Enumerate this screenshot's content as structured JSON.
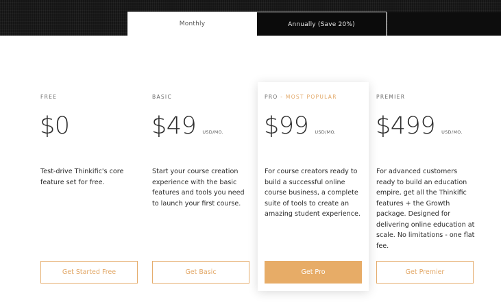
{
  "toggle": {
    "monthly_label": "Monthly",
    "annual_label": "Annually (Save 20%)",
    "selected": "Monthly"
  },
  "plans": [
    {
      "name": "FREE",
      "tag": "",
      "price": "$0",
      "unit": "",
      "description": "Test-drive Thinkific's core feature set for free.",
      "cta": "Get Started Free"
    },
    {
      "name": "BASIC",
      "tag": "",
      "price": "$49",
      "unit": "USD/MO.",
      "description": "Start your course creation experience with the basic features and tools you need to launch your first course.",
      "cta": "Get Basic"
    },
    {
      "name": "PRO",
      "tag": " - MOST POPULAR",
      "price": "$99",
      "unit": "USD/MO.",
      "description": "For course creators ready to build a successful online course business, a complete suite of tools to create an amazing student experience.",
      "cta": "Get Pro"
    },
    {
      "name": "PREMIER",
      "tag": "",
      "price": "$499",
      "unit": "USD/MO.",
      "description": "For advanced customers ready to build an education empire, get all the Thinkific features + the Growth package. Designed for delivering online education at scale. No limitations - one flat fee.",
      "cta": "Get Premier"
    }
  ],
  "colors": {
    "accent": "#e7ac67",
    "dark_band": "#151515",
    "text": "#2b2b2b"
  }
}
